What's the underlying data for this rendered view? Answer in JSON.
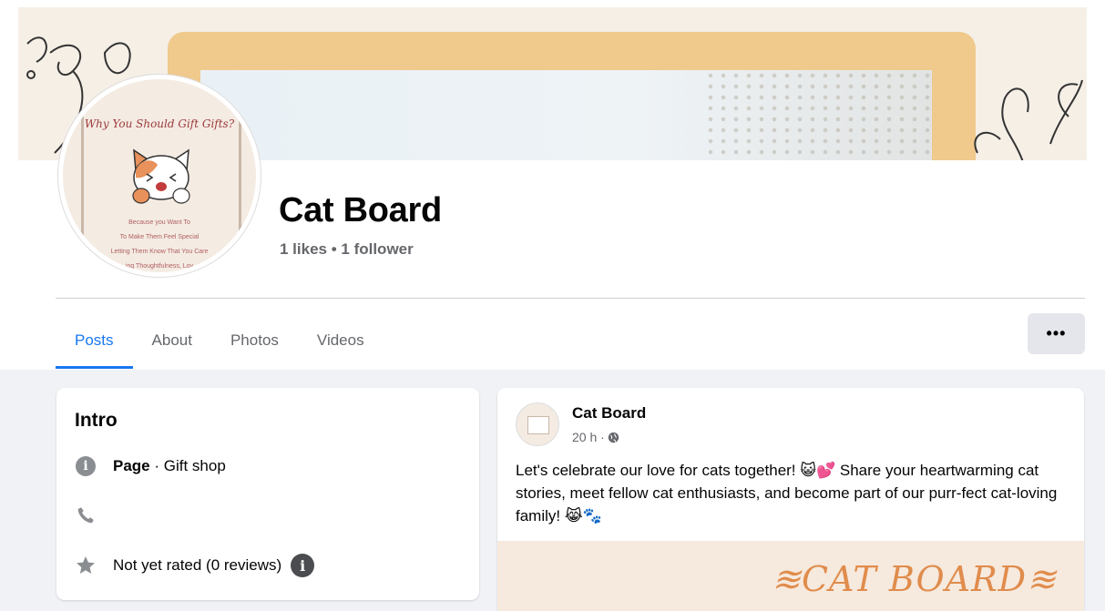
{
  "colors": {
    "accent": "#1877f2",
    "muted": "#65676b",
    "background": "#f0f2f5",
    "button": "#e4e6eb"
  },
  "page": {
    "name": "Cat Board",
    "stats": "1 likes • 1 follower"
  },
  "avatar": {
    "headline": "Why You Should Gift Gifts?",
    "lines": [
      "Because you Want To",
      "To Make Them Feel Special",
      "Letting Them Know That You Care",
      "ing Thoughtfulness, Lov"
    ]
  },
  "tabs": [
    {
      "label": "Posts",
      "active": true
    },
    {
      "label": "About",
      "active": false
    },
    {
      "label": "Photos",
      "active": false
    },
    {
      "label": "Videos",
      "active": false
    }
  ],
  "more_button": {
    "label": "•••",
    "icon": "more-icon"
  },
  "intro": {
    "title": "Intro",
    "category_bold": "Page",
    "category_rest": " · Gift shop",
    "rating": "Not yet rated (0 reviews)"
  },
  "post": {
    "author": "Cat Board",
    "time": "20 h ·",
    "text": "Let's celebrate our love for cats together! 😺💕 Share your heartwarming cat stories, meet fellow cat enthusiasts, and become part of our purr-fect cat-loving family! 😹🐾",
    "banner_text": "≋CAT BOARD≋"
  }
}
